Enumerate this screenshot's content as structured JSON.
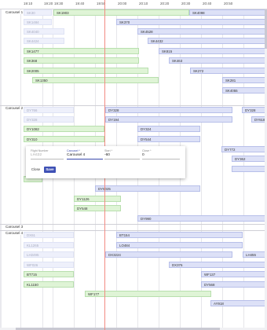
{
  "axis": {
    "ticks": [
      "19:10",
      "19:20",
      "19:30",
      "19:40",
      "19:50",
      "20:00",
      "20:10",
      "20:20",
      "20:30",
      "20:40",
      "20:50"
    ]
  },
  "carousels": [
    {
      "name": "Carousel 1"
    },
    {
      "name": "Carousel 2"
    },
    {
      "name": "Carousel 3"
    },
    {
      "name": "Carousel 4"
    }
  ],
  "flights": {
    "c1": [
      "SK30",
      "SK1903",
      "SK4098",
      "SK1484",
      "SK370",
      "SK4040",
      "SK4528",
      "SK4424",
      "SK4432",
      "SK1477",
      "SK815",
      "SK368",
      "SK463",
      "SK2005",
      "SK272",
      "SK1350",
      "SK281",
      "SK4055"
    ],
    "c2": [
      "DY766",
      "DY328",
      "DY834",
      "DY328",
      "DY194",
      "DY618",
      "DY1082",
      "DY324",
      "DY310",
      "DY544",
      "DY772",
      "DY362",
      "DY5025",
      "DY1126",
      "DY548",
      "DY990"
    ],
    "c4": [
      "DX61",
      "BT154",
      "KL1265",
      "LO484",
      "LH2495",
      "DX3224",
      "LH455",
      "WF026",
      "DX376",
      "BT715",
      "WF137",
      "KL1150",
      "DY568",
      "WF177",
      "AY918"
    ]
  },
  "dialog": {
    "flight_number_label": "Flight Number",
    "flight_number_value": "LH432",
    "carousel_label": "Carousel *",
    "carousel_value": "Carousel 4",
    "start_label": "Start *",
    "start_value": "-60",
    "close_label": "Close *",
    "close_value": "0",
    "close_button": "Close",
    "save_button": "Save"
  },
  "colors": {
    "green_bar": "#dff4d6",
    "blue_bar": "#dde1f7",
    "now_line": "#f28b82",
    "primary": "#3f51b5"
  }
}
